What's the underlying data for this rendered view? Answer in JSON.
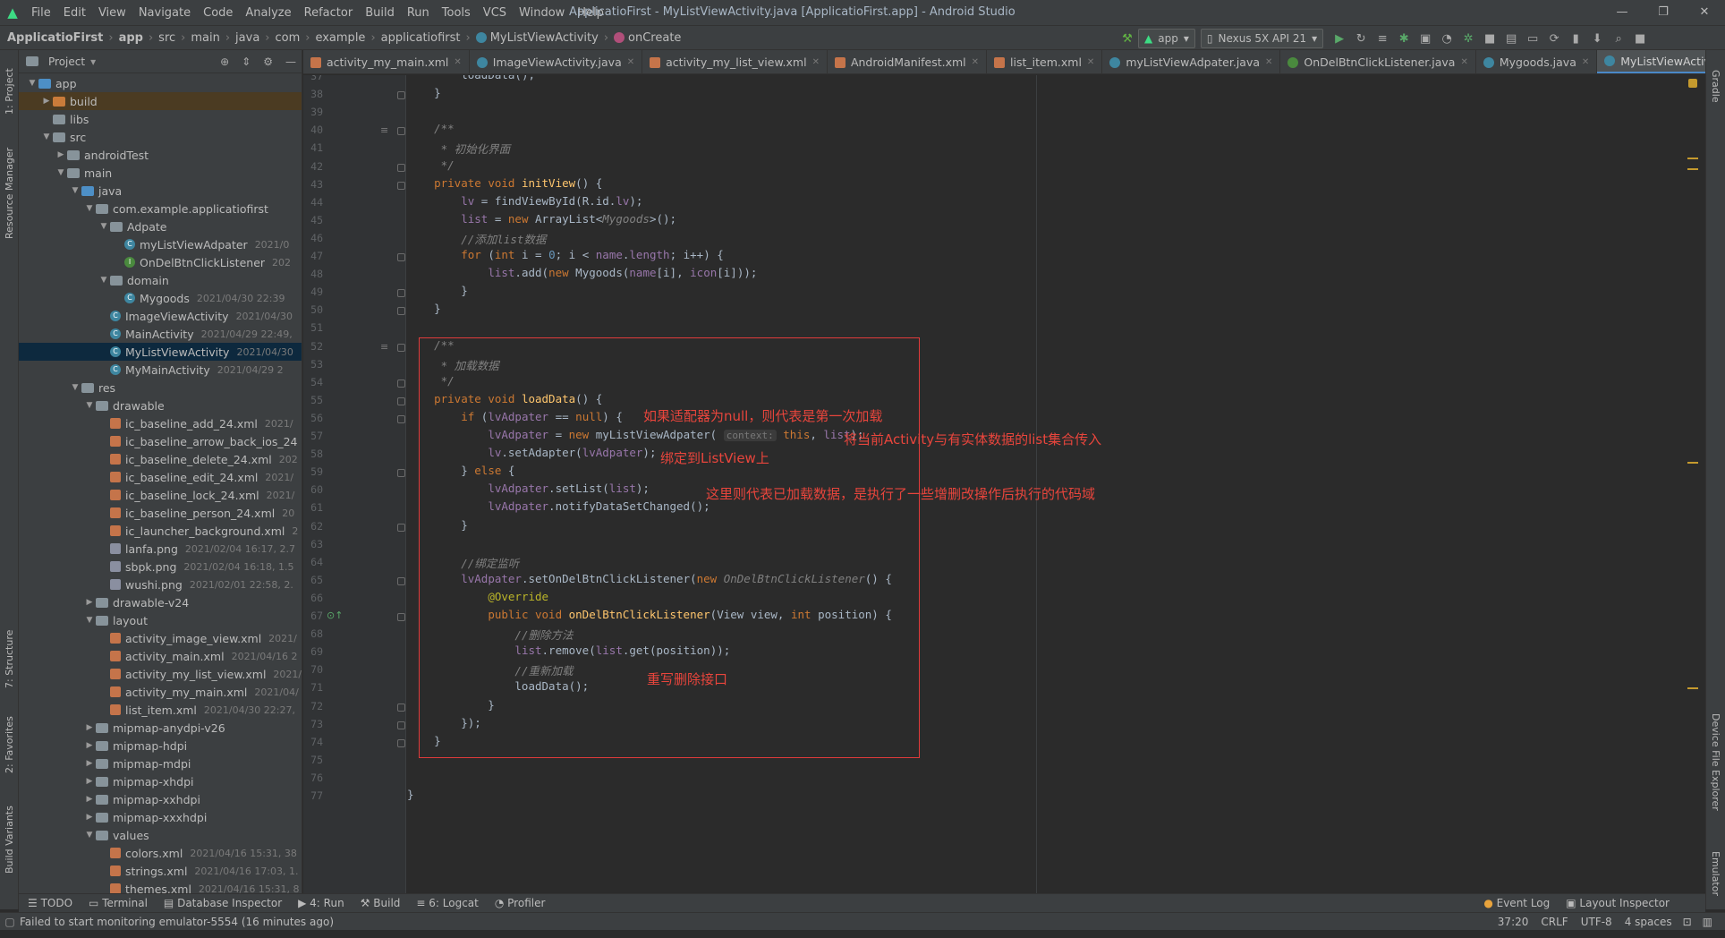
{
  "menubar": {
    "items": [
      "File",
      "Edit",
      "View",
      "Navigate",
      "Code",
      "Analyze",
      "Refactor",
      "Build",
      "Run",
      "Tools",
      "VCS",
      "Window",
      "Help"
    ]
  },
  "window": {
    "title": "ApplicatioFirst - MyListViewActivity.java [ApplicatioFirst.app] - Android Studio"
  },
  "breadcrumb": [
    "ApplicatioFirst",
    "app",
    "src",
    "main",
    "java",
    "com",
    "example",
    "applicatiofirst",
    "MyListViewActivity",
    "onCreate"
  ],
  "toolbar": {
    "run_config": "app",
    "device": "Nexus 5X API 21"
  },
  "project_panel": {
    "title": "Project",
    "tree": [
      {
        "label": "app",
        "depth": 0,
        "arrow": "down",
        "icon": "folder-blue",
        "date": ""
      },
      {
        "label": "build",
        "depth": 1,
        "arrow": "right",
        "icon": "folder-orange",
        "date": ""
      },
      {
        "label": "libs",
        "depth": 1,
        "arrow": "",
        "icon": "folder",
        "date": ""
      },
      {
        "label": "src",
        "depth": 1,
        "arrow": "down",
        "icon": "folder",
        "date": ""
      },
      {
        "label": "androidTest",
        "depth": 2,
        "arrow": "right",
        "icon": "folder",
        "date": ""
      },
      {
        "label": "main",
        "depth": 2,
        "arrow": "down",
        "icon": "folder",
        "date": ""
      },
      {
        "label": "java",
        "depth": 3,
        "arrow": "down",
        "icon": "folder-blue",
        "date": ""
      },
      {
        "label": "com.example.applicatiofirst",
        "depth": 4,
        "arrow": "down",
        "icon": "folder",
        "date": ""
      },
      {
        "label": "Adpate",
        "depth": 5,
        "arrow": "down",
        "icon": "folder",
        "date": ""
      },
      {
        "label": "myListViewAdpater",
        "depth": 6,
        "arrow": "",
        "icon": "class",
        "date": "2021/0"
      },
      {
        "label": "OnDelBtnClickListener",
        "depth": 6,
        "arrow": "",
        "icon": "interface",
        "date": "202"
      },
      {
        "label": "domain",
        "depth": 5,
        "arrow": "down",
        "icon": "folder",
        "date": ""
      },
      {
        "label": "Mygoods",
        "depth": 6,
        "arrow": "",
        "icon": "class",
        "date": "2021/04/30 22:39"
      },
      {
        "label": "ImageViewActivity",
        "depth": 5,
        "arrow": "",
        "icon": "class",
        "date": "2021/04/30"
      },
      {
        "label": "MainActivity",
        "depth": 5,
        "arrow": "",
        "icon": "class",
        "date": "2021/04/29 22:49,"
      },
      {
        "label": "MyListViewActivity",
        "depth": 5,
        "arrow": "",
        "icon": "class",
        "date": "2021/04/30",
        "selected": true
      },
      {
        "label": "MyMainActivity",
        "depth": 5,
        "arrow": "",
        "icon": "class",
        "date": "2021/04/29 2"
      },
      {
        "label": "res",
        "depth": 3,
        "arrow": "down",
        "icon": "folder",
        "date": ""
      },
      {
        "label": "drawable",
        "depth": 4,
        "arrow": "down",
        "icon": "folder",
        "date": ""
      },
      {
        "label": "ic_baseline_add_24.xml",
        "depth": 5,
        "arrow": "",
        "icon": "xml",
        "date": "2021/"
      },
      {
        "label": "ic_baseline_arrow_back_ios_24",
        "depth": 5,
        "arrow": "",
        "icon": "xml",
        "date": ""
      },
      {
        "label": "ic_baseline_delete_24.xml",
        "depth": 5,
        "arrow": "",
        "icon": "xml",
        "date": "202"
      },
      {
        "label": "ic_baseline_edit_24.xml",
        "depth": 5,
        "arrow": "",
        "icon": "xml",
        "date": "2021/"
      },
      {
        "label": "ic_baseline_lock_24.xml",
        "depth": 5,
        "arrow": "",
        "icon": "xml",
        "date": "2021/"
      },
      {
        "label": "ic_baseline_person_24.xml",
        "depth": 5,
        "arrow": "",
        "icon": "xml",
        "date": "20"
      },
      {
        "label": "ic_launcher_background.xml",
        "depth": 5,
        "arrow": "",
        "icon": "xml",
        "date": "2"
      },
      {
        "label": "lanfa.png",
        "depth": 5,
        "arrow": "",
        "icon": "png",
        "date": "2021/02/04 16:17, 2.7"
      },
      {
        "label": "sbpk.png",
        "depth": 5,
        "arrow": "",
        "icon": "png",
        "date": "2021/02/04 16:18, 1.5"
      },
      {
        "label": "wushi.png",
        "depth": 5,
        "arrow": "",
        "icon": "png",
        "date": "2021/02/01 22:58, 2."
      },
      {
        "label": "drawable-v24",
        "depth": 4,
        "arrow": "right",
        "icon": "folder",
        "date": ""
      },
      {
        "label": "layout",
        "depth": 4,
        "arrow": "down",
        "icon": "folder",
        "date": ""
      },
      {
        "label": "activity_image_view.xml",
        "depth": 5,
        "arrow": "",
        "icon": "xml",
        "date": "2021/"
      },
      {
        "label": "activity_main.xml",
        "depth": 5,
        "arrow": "",
        "icon": "xml",
        "date": "2021/04/16 2"
      },
      {
        "label": "activity_my_list_view.xml",
        "depth": 5,
        "arrow": "",
        "icon": "xml",
        "date": "2021/"
      },
      {
        "label": "activity_my_main.xml",
        "depth": 5,
        "arrow": "",
        "icon": "xml",
        "date": "2021/04/"
      },
      {
        "label": "list_item.xml",
        "depth": 5,
        "arrow": "",
        "icon": "xml",
        "date": "2021/04/30 22:27,"
      },
      {
        "label": "mipmap-anydpi-v26",
        "depth": 4,
        "arrow": "right",
        "icon": "folder",
        "date": ""
      },
      {
        "label": "mipmap-hdpi",
        "depth": 4,
        "arrow": "right",
        "icon": "folder",
        "date": ""
      },
      {
        "label": "mipmap-mdpi",
        "depth": 4,
        "arrow": "right",
        "icon": "folder",
        "date": ""
      },
      {
        "label": "mipmap-xhdpi",
        "depth": 4,
        "arrow": "right",
        "icon": "folder",
        "date": ""
      },
      {
        "label": "mipmap-xxhdpi",
        "depth": 4,
        "arrow": "right",
        "icon": "folder",
        "date": ""
      },
      {
        "label": "mipmap-xxxhdpi",
        "depth": 4,
        "arrow": "right",
        "icon": "folder",
        "date": ""
      },
      {
        "label": "values",
        "depth": 4,
        "arrow": "down",
        "icon": "folder",
        "date": ""
      },
      {
        "label": "colors.xml",
        "depth": 5,
        "arrow": "",
        "icon": "xml",
        "date": "2021/04/16 15:31, 38"
      },
      {
        "label": "strings.xml",
        "depth": 5,
        "arrow": "",
        "icon": "xml",
        "date": "2021/04/16 17:03, 1."
      },
      {
        "label": "themes.xml",
        "depth": 5,
        "arrow": "",
        "icon": "xml",
        "date": "2021/04/16 15:31, 8"
      }
    ]
  },
  "editor_tabs": [
    {
      "label": "activity_my_main.xml",
      "icon": "xml",
      "active": false
    },
    {
      "label": "ImageViewActivity.java",
      "icon": "c",
      "active": false
    },
    {
      "label": "activity_my_list_view.xml",
      "icon": "xml",
      "active": false
    },
    {
      "label": "AndroidManifest.xml",
      "icon": "xml",
      "active": false
    },
    {
      "label": "list_item.xml",
      "icon": "xml",
      "active": false
    },
    {
      "label": "myListViewAdpater.java",
      "icon": "c",
      "active": false
    },
    {
      "label": "OnDelBtnClickListener.java",
      "icon": "i",
      "active": false
    },
    {
      "label": "Mygoods.java",
      "icon": "c",
      "active": false
    },
    {
      "label": "MyListViewActivity.java",
      "icon": "c",
      "active": true
    }
  ],
  "code_lines": [
    {
      "n": 37,
      "html": "        <span>loadData();</span>"
    },
    {
      "n": 38,
      "html": "    }"
    },
    {
      "n": 39,
      "html": ""
    },
    {
      "n": 40,
      "html": "    <span class=\"cm\">/**</span>"
    },
    {
      "n": 41,
      "html": "    <span class=\"cm\"> * 初始化界面</span>"
    },
    {
      "n": 42,
      "html": "    <span class=\"cm\"> */</span>"
    },
    {
      "n": 43,
      "html": "    <span class=\"kw\">private void </span><span class=\"fn\">initView</span>() {"
    },
    {
      "n": 44,
      "html": "        <span class=\"fld\">lv</span> = findViewById(R.id.<span class=\"fld\">lv</span>);"
    },
    {
      "n": 45,
      "html": "        <span class=\"fld\">list</span> = <span class=\"kw\">new </span>ArrayList&lt;<span class=\"cm\">Mygoods</span>&gt;();"
    },
    {
      "n": 46,
      "html": "        <span class=\"cm\">//添加list数据</span>"
    },
    {
      "n": 47,
      "html": "        <span class=\"kw\">for </span>(<span class=\"kw\">int </span>i = <span class=\"num\">0</span>; i &lt; <span class=\"fld\">name</span>.<span class=\"fld\">length</span>; i++) {"
    },
    {
      "n": 48,
      "html": "            <span class=\"fld\">list</span>.add(<span class=\"kw\">new </span>Mygoods(<span class=\"fld\">name</span>[i], <span class=\"fld\">icon</span>[i]));"
    },
    {
      "n": 49,
      "html": "        }"
    },
    {
      "n": 50,
      "html": "    }"
    },
    {
      "n": 51,
      "html": ""
    },
    {
      "n": 52,
      "html": "    <span class=\"cm\">/**</span>"
    },
    {
      "n": 53,
      "html": "    <span class=\"cm\"> * 加载数据</span>"
    },
    {
      "n": 54,
      "html": "    <span class=\"cm\"> */</span>"
    },
    {
      "n": 55,
      "html": "    <span class=\"kw\">private void </span><span class=\"fn\">loadData</span>() {"
    },
    {
      "n": 56,
      "html": "        <span class=\"kw\">if </span>(<span class=\"fld\">lvAdpater</span> == <span class=\"kw\">null</span>) {"
    },
    {
      "n": 57,
      "html": "            <span class=\"fld\">lvAdpater</span> = <span class=\"kw\">new </span>myListViewAdpater( <span class=\"hint\">context:</span> <span class=\"kw\">this</span>, <span class=\"fld\">list</span>);"
    },
    {
      "n": 58,
      "html": "            <span class=\"fld\">lv</span>.setAdapter(<span class=\"fld\">lvAdpater</span>);"
    },
    {
      "n": 59,
      "html": "        } <span class=\"kw\">else </span>{"
    },
    {
      "n": 60,
      "html": "            <span class=\"fld\">lvAdpater</span>.setList(<span class=\"fld\">list</span>);"
    },
    {
      "n": 61,
      "html": "            <span class=\"fld\">lvAdpater</span>.notifyDataSetChanged();"
    },
    {
      "n": 62,
      "html": "        }"
    },
    {
      "n": 63,
      "html": ""
    },
    {
      "n": 64,
      "html": "        <span class=\"cm\">//绑定监听</span>"
    },
    {
      "n": 65,
      "html": "        <span class=\"fld\">lvAdpater</span>.setOnDelBtnClickListener(<span class=\"kw\">new </span><span class=\"cm\">OnDelBtnClickListener</span>() {"
    },
    {
      "n": 66,
      "html": "            <span class=\"ann\">@Override</span>"
    },
    {
      "n": 67,
      "html": "            <span class=\"kw\">public void </span><span class=\"fn\">onDelBtnClickListener</span>(View view, <span class=\"kw\">int </span>position) {"
    },
    {
      "n": 68,
      "html": "                <span class=\"cm\">//删除方法</span>"
    },
    {
      "n": 69,
      "html": "                <span class=\"fld\">list</span>.remove(<span class=\"fld\">list</span>.get(position));"
    },
    {
      "n": 70,
      "html": "                <span class=\"cm\">//重新加载</span>"
    },
    {
      "n": 71,
      "html": "                loadData();"
    },
    {
      "n": 72,
      "html": "            }"
    },
    {
      "n": 73,
      "html": "        });"
    },
    {
      "n": 74,
      "html": "    }"
    },
    {
      "n": 75,
      "html": ""
    },
    {
      "n": 76,
      "html": ""
    },
    {
      "n": 77,
      "html": "}"
    }
  ],
  "annotations": [
    "如果适配器为null，则代表是第一次加载",
    "将当前Activity与有实体数据的list集合传入",
    "绑定到ListView上",
    "这里则代表已加载数据，是执行了一些增删改操作后执行的代码域",
    "重写删除接口"
  ],
  "left_tool_tabs": [
    "1: Project",
    "Resource Manager",
    "7: Structure",
    "2: Favorites",
    "Build Variants"
  ],
  "right_tool_tabs": [
    "Gradle",
    "Device File Explorer",
    "Emulator"
  ],
  "bottom_tools": {
    "left": [
      "TODO",
      "Terminal",
      "Database Inspector",
      "4: Run",
      "Build",
      "6: Logcat",
      "Profiler"
    ],
    "right": [
      "Event Log",
      "Layout Inspector"
    ]
  },
  "status": {
    "message": "Failed to start monitoring emulator-5554 (16 minutes ago)",
    "position": "37:20",
    "line_sep": "CRLF",
    "encoding": "UTF-8",
    "indent": "4 spaces"
  },
  "colors": {
    "annotation_red": "#e8453c",
    "selection": "#0d293e",
    "accent": "#4a88c7"
  }
}
